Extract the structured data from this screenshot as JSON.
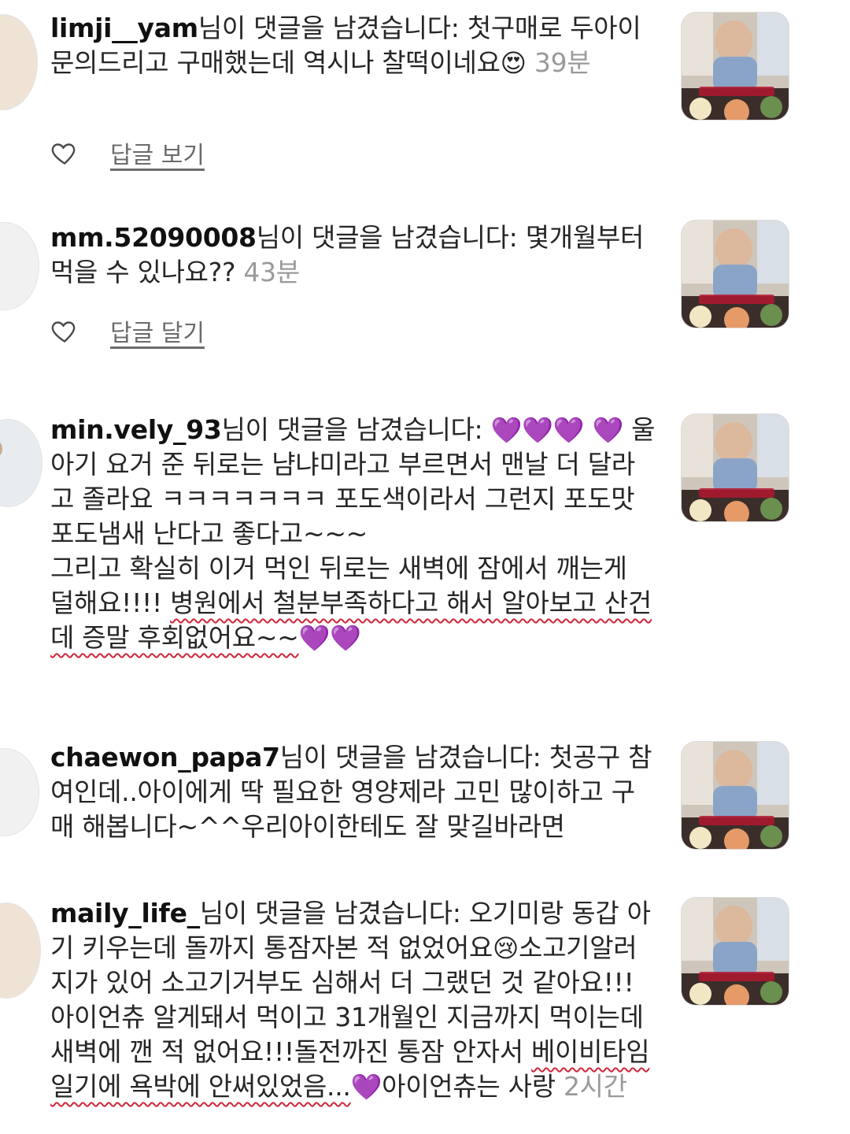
{
  "notifications": [
    {
      "username": "limji__yam",
      "action_text": "님이 댓글을 남겼습니다:",
      "comment": " 첫구매로 두아이 문의드리고 구매했는데 역시나 찰떡이네요",
      "emoji": "😍",
      "time": "39분",
      "reply_label": "답글 보기"
    },
    {
      "username": "mm.52090008",
      "action_text": "님이 댓글을 남겼습니다:",
      "comment": " 몇개월부터 먹을 수 있나요??",
      "time": "43분",
      "reply_label": "답글 달기"
    },
    {
      "username": "min.vely_93",
      "action_text": "님이 댓글을 남겼습니다:",
      "lead_emoji": "💜💜💜",
      "line2_emoji": "💜",
      "comment_a": " 울아기 요거 준 뒤로는 냠냐미라고 부르면서 맨날 더 달라고 졸라요 ㅋㅋㅋㅋㅋㅋㅋ 포도색이라서 그런지 포도맛 포도냄새 난다고 좋다고~~~",
      "comment_b_pre": "그리고 확실히 이거 먹인 뒤로는 새벽에 잠에서 깨는게 덜해요!!!! ",
      "comment_b_underlined": "병원에서 철분부족하다고 해서 알아보고 산건데 증말 후회없어요~~",
      "end_emoji": "💜💜"
    },
    {
      "username": "chaewon_papa7",
      "action_text": "님이 댓글을 남겼습니다:",
      "comment": " 첫공구 참여인데..아이에게 딱 필요한 영양제라 고민 많이하고 구매 해봅니다~^^우리아이한테도 잘 맞길바라면"
    },
    {
      "username": "maily_life_",
      "action_text": "님이 댓글을 남겼습니다:",
      "comment_a": " 오기미랑 동갑 아기 키우는데 돌까지 통잠자본 적 없었어요",
      "cry_emoji": "😢",
      "comment_b": "소고기알러지가 있어 소고기거부도 심해서 더 그랬던 것 같아요!!!아이언츄 알게돼서 먹이고 31개월인 지금까지 먹이는데 새벽에 깬 적 없어요!!!돌전까진 통잠 안자서 ",
      "comment_underlined": "베이비타임 일기에 욕박에 안써있었음...",
      "heart_emoji": "💜",
      "comment_c": "아이언츄는 사랑",
      "time": "2시간"
    }
  ],
  "colors": {
    "text": "#262626",
    "time": "#9a9a9a",
    "underline": "#d0263b",
    "purple_heart": "#8a2be2"
  },
  "icons": {
    "like": "heart-outline-icon"
  }
}
